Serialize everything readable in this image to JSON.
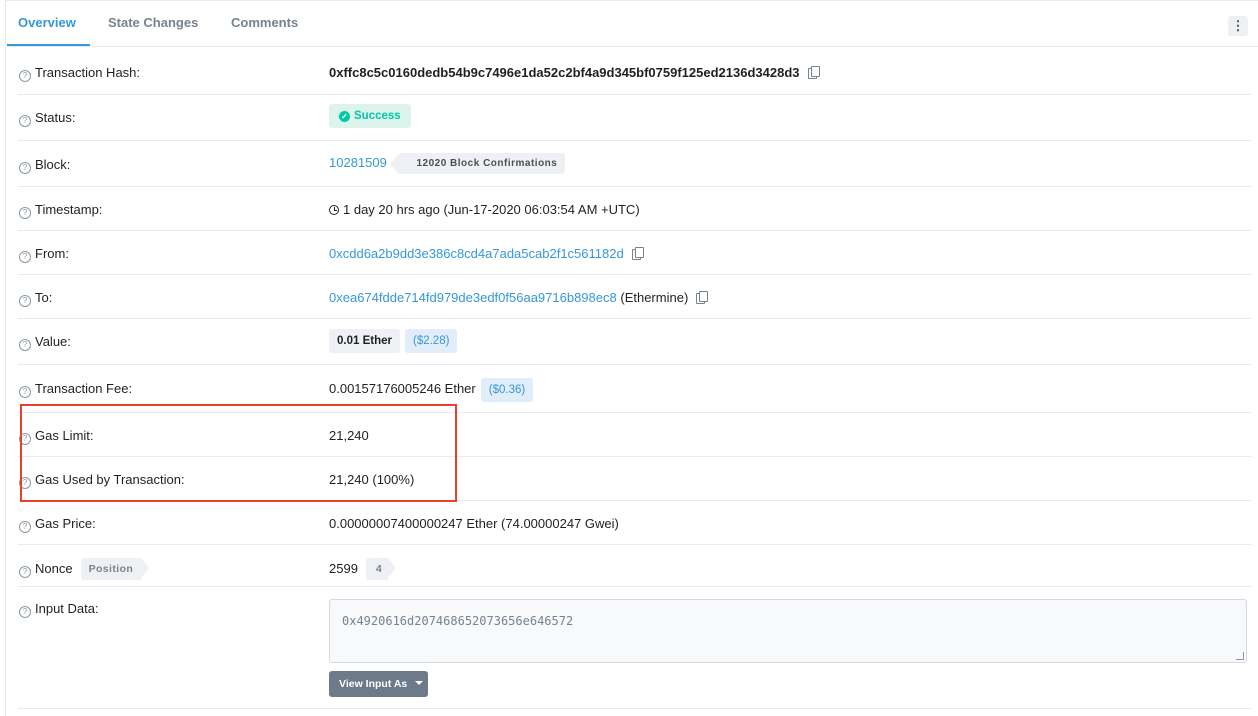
{
  "tabs": [
    {
      "label": "Overview",
      "active": true
    },
    {
      "label": "State Changes",
      "active": false
    },
    {
      "label": "Comments",
      "active": false
    }
  ],
  "menu_icon": "⋮",
  "help_icon_glyph": "?",
  "rows": {
    "tx_hash": {
      "label": "Transaction Hash:",
      "value": "0xffc8c5c0160dedb54b9c7496e1da52c2bf4a9d345bf0759f125ed2136d3428d3"
    },
    "status": {
      "label": "Status:",
      "value": "Success"
    },
    "block": {
      "label": "Block:",
      "value": "10281509",
      "confirmations": "12020 Block Confirmations"
    },
    "timestamp": {
      "label": "Timestamp:",
      "value": "1 day 20 hrs ago (Jun-17-2020 06:03:54 AM +UTC)"
    },
    "from": {
      "label": "From:",
      "value": "0xcdd6a2b9dd3e386c8cd4a7ada5cab2f1c561182d"
    },
    "to": {
      "label": "To:",
      "value": "0xea674fdde714fd979de3edf0f56aa9716b898ec8",
      "name": "(Ethermine)"
    },
    "value": {
      "label": "Value:",
      "ether": "0.01 Ether",
      "usd": "($2.28)"
    },
    "fee": {
      "label": "Transaction Fee:",
      "value": "0.00157176005246 Ether",
      "usd": "($0.36)"
    },
    "gas_limit": {
      "label": "Gas Limit:",
      "value": "21,240"
    },
    "gas_used": {
      "label": "Gas Used by Transaction:",
      "value": "21,240 (100%)"
    },
    "gas_price": {
      "label": "Gas Price:",
      "value": "0.00000007400000247 Ether (74.00000247 Gwei)"
    },
    "nonce": {
      "label": "Nonce",
      "position_label": "Position",
      "value": "2599",
      "position": "4"
    },
    "input_data": {
      "label": "Input Data:",
      "value": "0x4920616d207468652073656e646572",
      "button": "View Input As"
    }
  },
  "colors": {
    "link": "#3498db",
    "success": "#00c9a7",
    "highlight": "#e8402a"
  }
}
